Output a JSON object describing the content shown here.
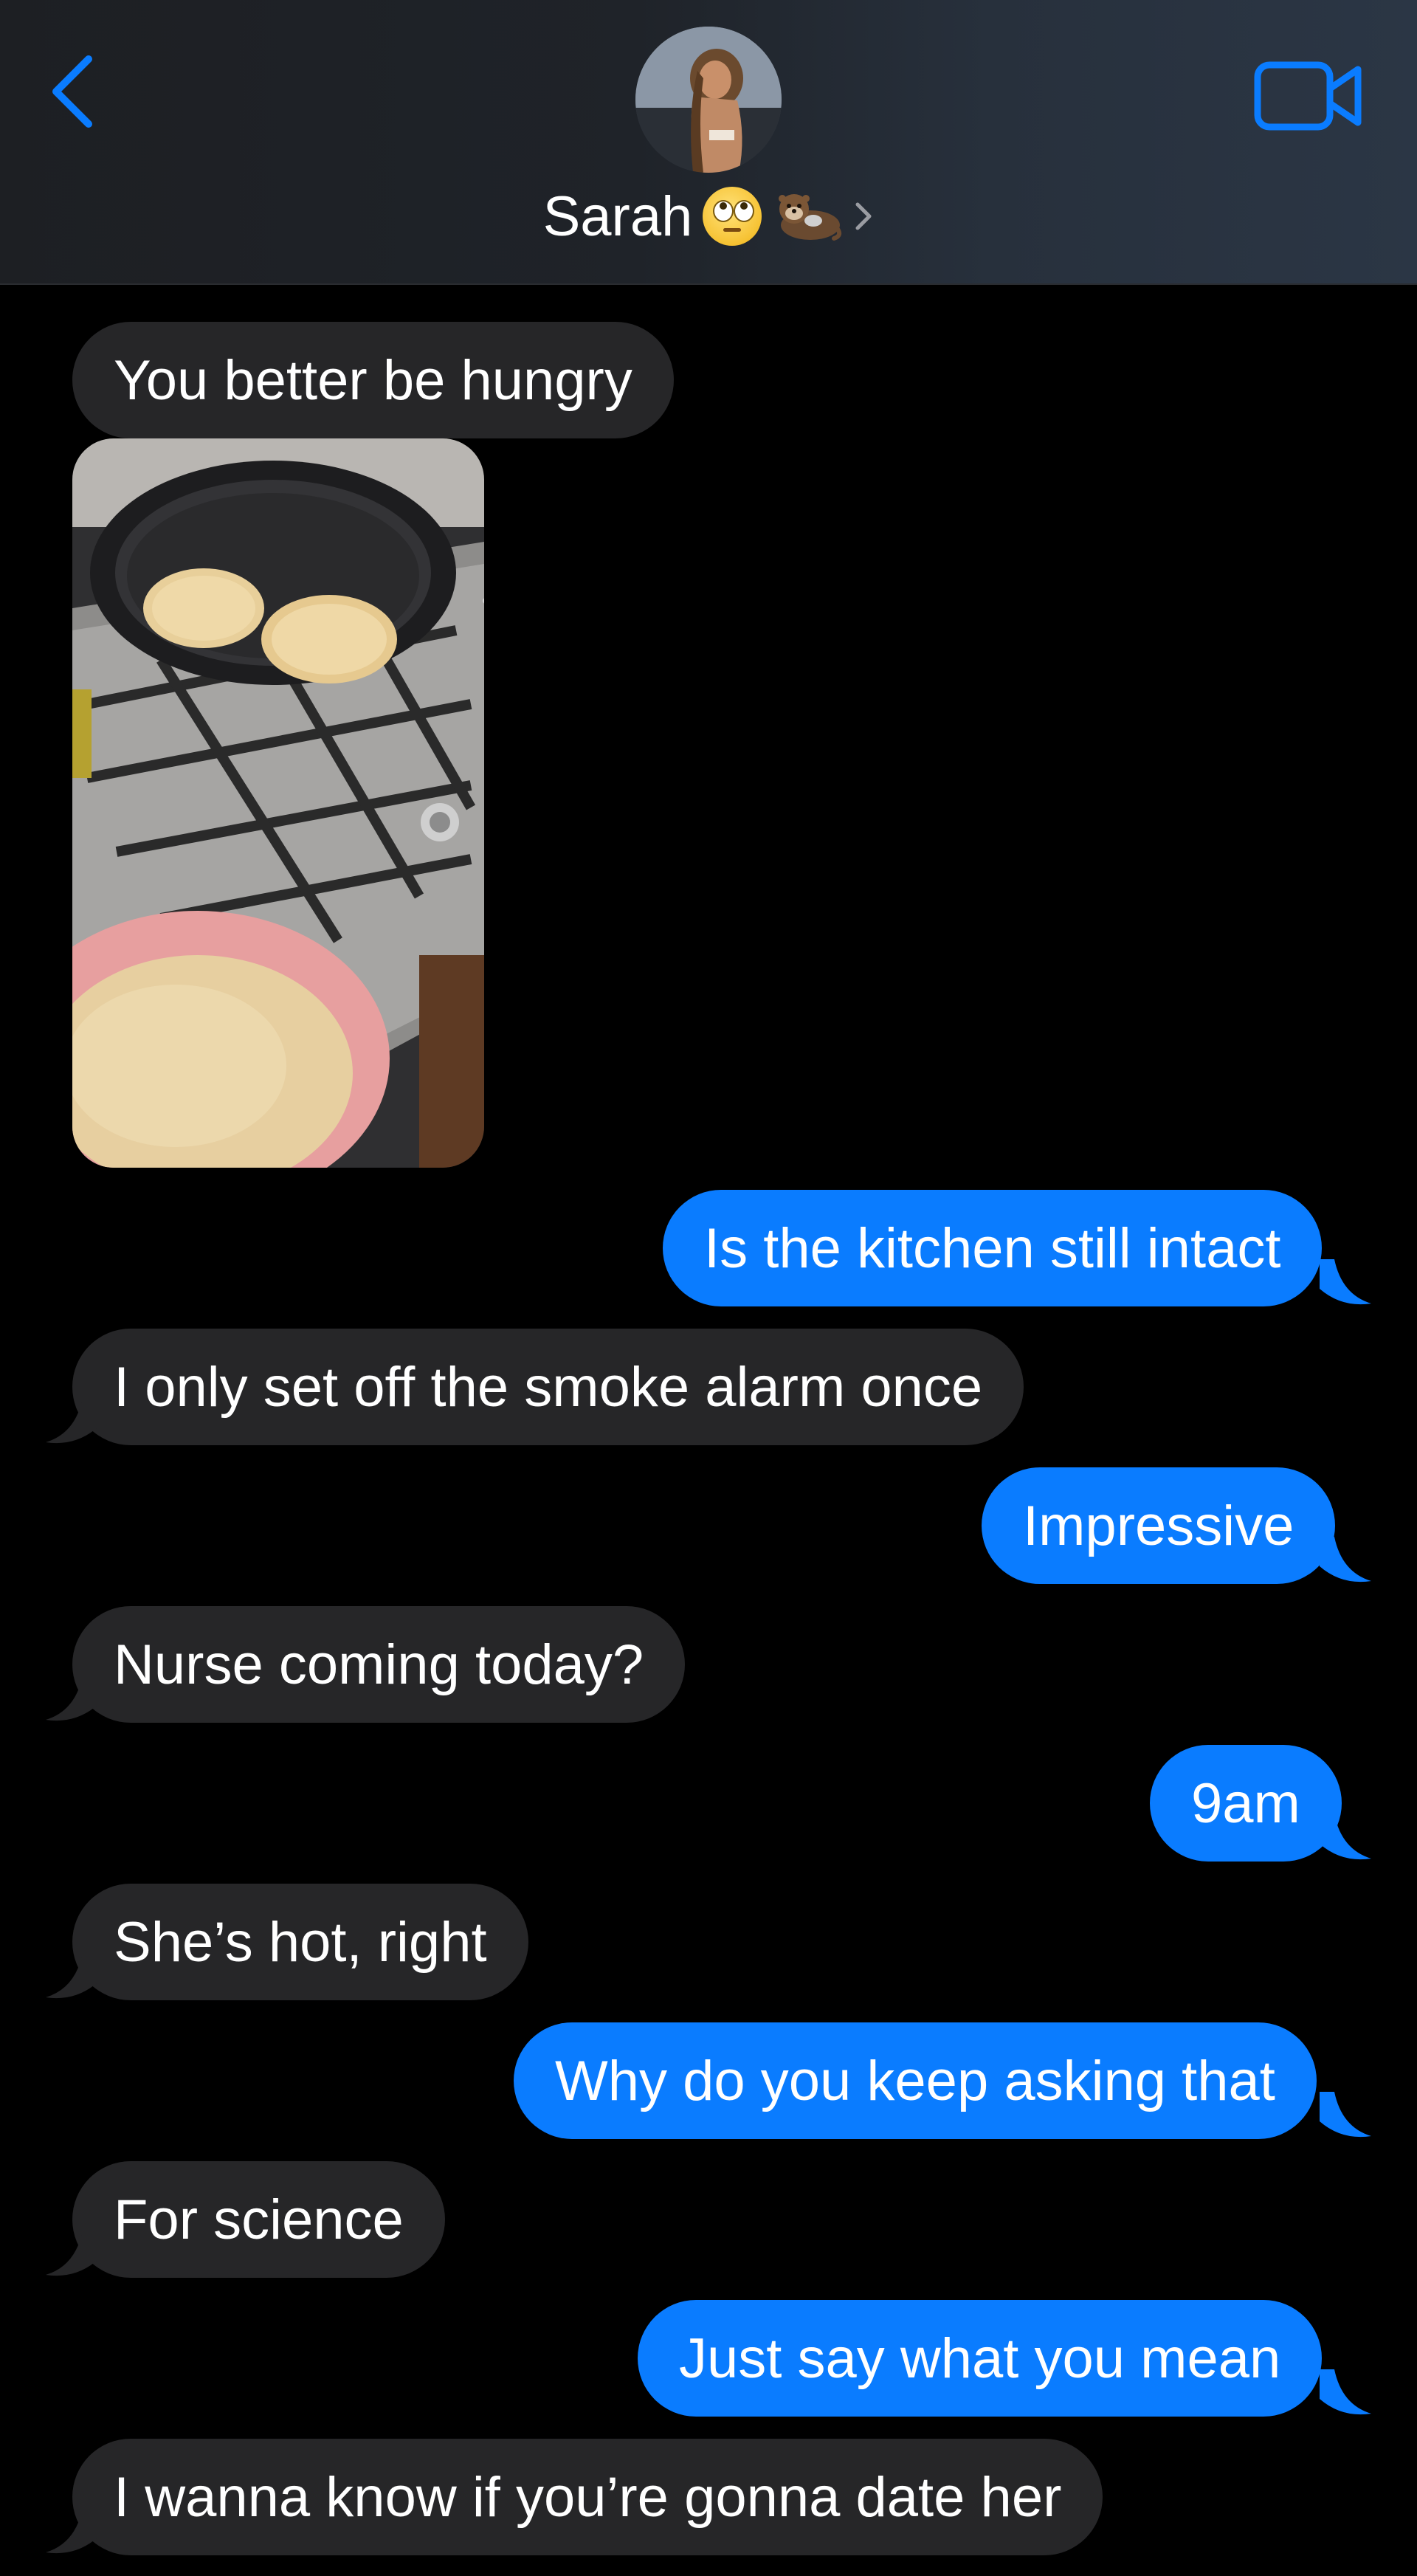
{
  "header": {
    "contact_name": "Sarah",
    "name_emojis": [
      "face-with-rolling-eyes-emoji",
      "otter-emoji"
    ],
    "back_icon": "chevron-left-icon",
    "call_icon": "video-camera-icon",
    "accent_color": "#0a7cff"
  },
  "colors": {
    "background": "#000000",
    "incoming_bubble": "#262628",
    "outgoing_bubble": "#0a7cff",
    "text": "#ffffff"
  },
  "messages": [
    {
      "direction": "incoming",
      "text": "You better be hungry"
    },
    {
      "direction": "incoming",
      "type": "photo",
      "subject": "pancakes-in-pan-photo"
    },
    {
      "direction": "outgoing",
      "text": "Is the kitchen still intact"
    },
    {
      "direction": "incoming",
      "text": "I only set off the smoke alarm once"
    },
    {
      "direction": "outgoing",
      "text": "Impressive"
    },
    {
      "direction": "incoming",
      "text": "Nurse coming today?"
    },
    {
      "direction": "outgoing",
      "text": "9am"
    },
    {
      "direction": "incoming",
      "text": "She’s hot, right"
    },
    {
      "direction": "outgoing",
      "text": "Why do you keep asking that"
    },
    {
      "direction": "incoming",
      "text": "For science"
    },
    {
      "direction": "outgoing",
      "text": "Just say what you mean"
    },
    {
      "direction": "incoming",
      "text": "I wanna know if you’re gonna date her"
    }
  ]
}
